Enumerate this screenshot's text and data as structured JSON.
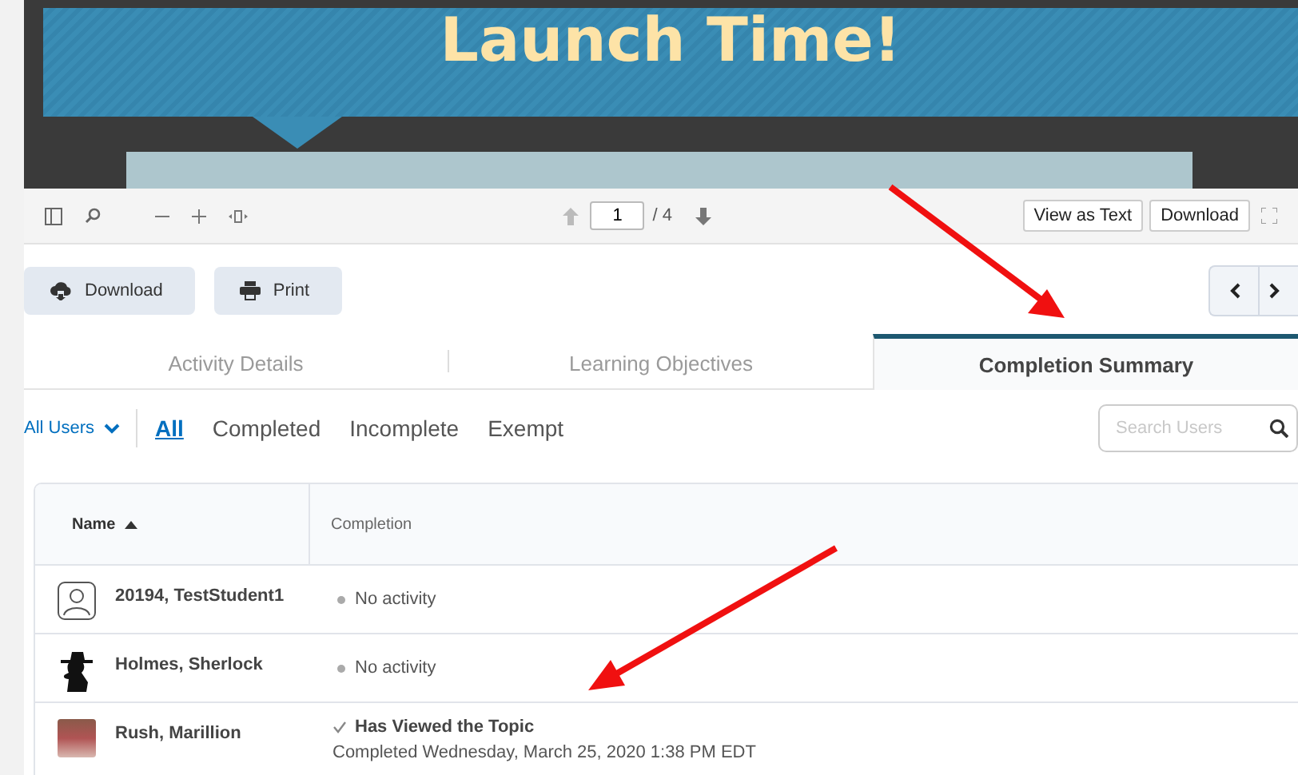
{
  "slide": {
    "title": "Launch Time!"
  },
  "pdf_toolbar": {
    "page": "1",
    "page_count": "/ 4",
    "buttons": [
      "View as Text",
      "Download"
    ]
  },
  "actions": [
    {
      "label": "Download",
      "kind": "download"
    },
    {
      "label": "Print",
      "kind": "print"
    }
  ],
  "tabs": [
    {
      "label": "Activity Details",
      "selected": false
    },
    {
      "label": "Learning Objectives",
      "selected": false
    },
    {
      "label": "Completion Summary",
      "selected": true
    }
  ],
  "filter": {
    "dropdown": "All Users",
    "options": [
      {
        "label": "All",
        "selected": true
      },
      {
        "label": "Completed",
        "selected": false
      },
      {
        "label": "Incomplete",
        "selected": false
      },
      {
        "label": "Exempt",
        "selected": false
      }
    ],
    "search": {
      "placeholder": "Search Users"
    }
  },
  "table": {
    "columns": [
      "Name",
      "Completion"
    ],
    "rows": [
      {
        "name": "20194, TestStudent1",
        "avatar": {
          "kind": "generic"
        },
        "kind": "none",
        "status": "No activity"
      },
      {
        "name": "Holmes, Sherlock",
        "avatar": {
          "kind": "silhouette"
        },
        "kind": "none",
        "status": "No activity"
      },
      {
        "name": "Rush, Marillion",
        "avatar": {
          "kind": "photo"
        },
        "kind": "viewed",
        "status": "Has Viewed the Topic",
        "detail": "Completed Wednesday, March 25, 2020 1:38 PM EDT"
      }
    ]
  }
}
